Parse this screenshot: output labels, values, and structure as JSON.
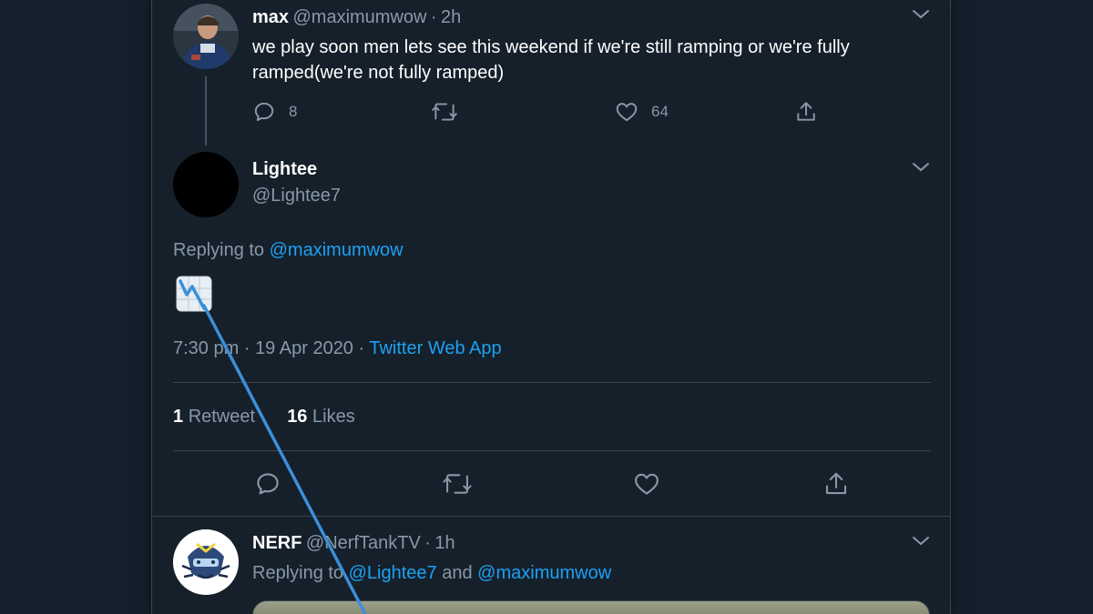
{
  "colors": {
    "background": "#15202b",
    "accent": "#1da1f2",
    "secondary_text": "#8899a6",
    "divider": "#38444d",
    "annotation_arrow": "#3b8fd9"
  },
  "parent_tweet": {
    "author_name": "max",
    "author_handle": "@maximumwow",
    "separator": "·",
    "time": "2h",
    "text_line1": "we play soon men lets see this weekend if we're still ramping or we're fully",
    "text_line2": "ramped(we're not fully ramped)",
    "reply_count": "8",
    "retweet_count": "",
    "like_count": "64",
    "icons": [
      "reply-icon",
      "retweet-icon",
      "like-icon",
      "share-icon",
      "chevron-down-icon"
    ]
  },
  "focused_tweet": {
    "author_name": "Lightee",
    "author_handle": "@Lightee7",
    "replying_prefix": "Replying to",
    "replying_to": "@maximumwow",
    "content_emoji": "chart-decreasing-emoji",
    "time": "7:30 pm",
    "separator": "·",
    "date": "19 Apr 2020",
    "separator2": "·",
    "source": "Twitter Web App",
    "retweets_num": "1",
    "retweets_label": "Retweet",
    "likes_num": "16",
    "likes_label": "Likes",
    "icons": [
      "reply-icon",
      "retweet-icon",
      "like-icon",
      "share-icon",
      "chevron-down-icon"
    ]
  },
  "reply_tweet": {
    "author_name": "NERF",
    "author_handle": "@NerfTankTV",
    "separator": "·",
    "time": "1h",
    "replying_prefix": "Replying to",
    "replying_to_1": "@Lightee7",
    "and": "and",
    "replying_to_2": "@maximumwow"
  }
}
